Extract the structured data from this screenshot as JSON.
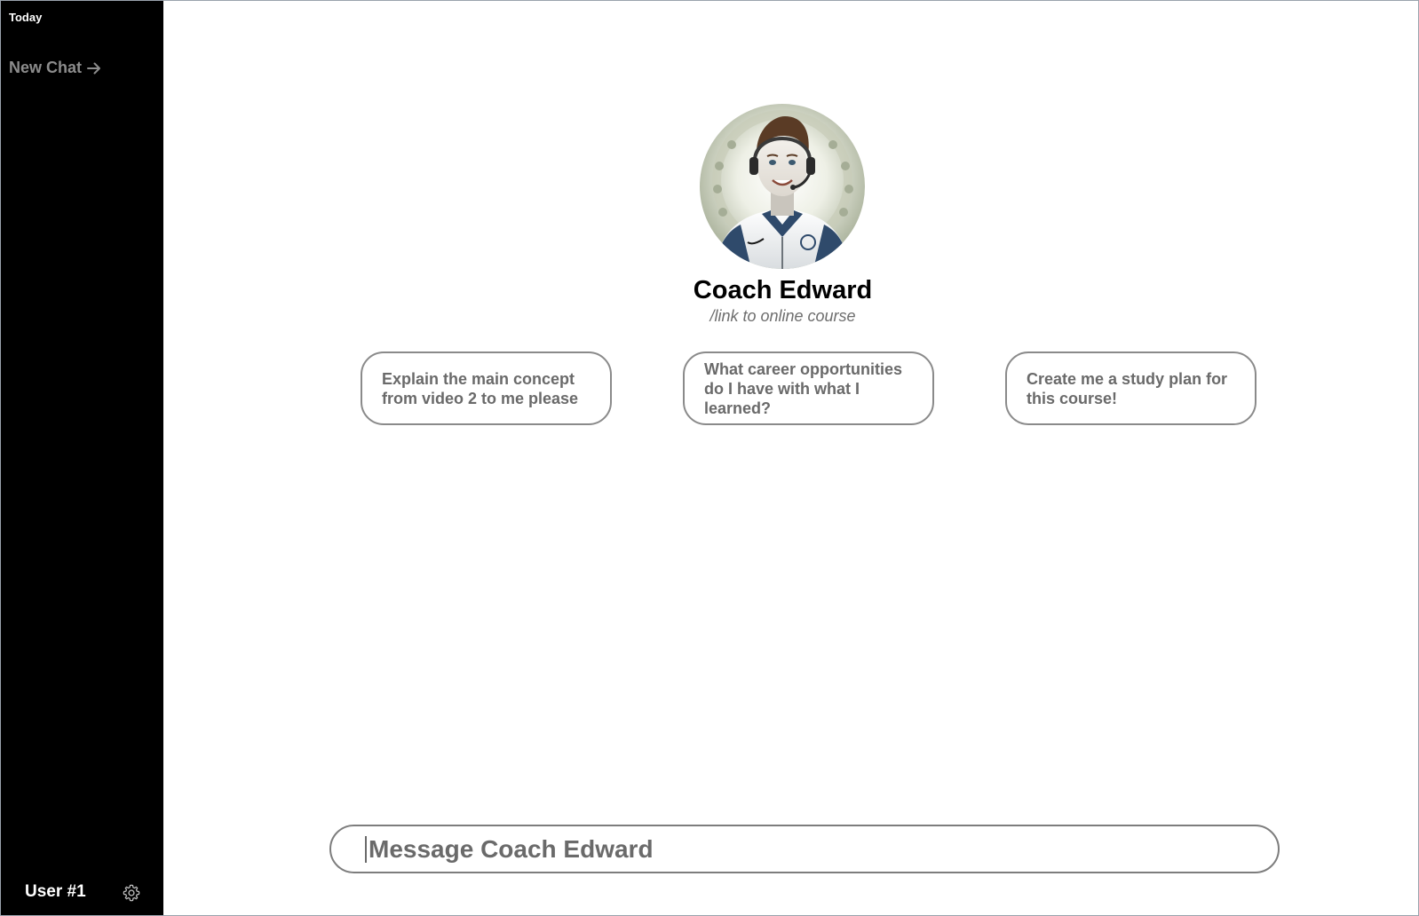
{
  "sidebar": {
    "section_label": "Today",
    "new_chat_label": "New Chat",
    "new_chat_icon": "arrow-right-icon",
    "user_label": "User #1",
    "settings_icon": "gear-icon"
  },
  "main": {
    "coach_name": "Coach Edward",
    "course_link": "/link to online course",
    "avatar_icon": "coach-avatar",
    "suggestions": [
      {
        "label": "Explain the main concept from video 2 to me please"
      },
      {
        "label": "What career opportunities do I have with what I learned?"
      },
      {
        "label": "Create me a study plan for this course!"
      }
    ],
    "composer": {
      "placeholder": "Message Coach Edward",
      "value": ""
    }
  },
  "colors": {
    "sidebar_bg": "#000000",
    "muted_text": "#8c8c8c",
    "suggestion_text": "#6a6a6a",
    "border": "#8a8a8a"
  }
}
